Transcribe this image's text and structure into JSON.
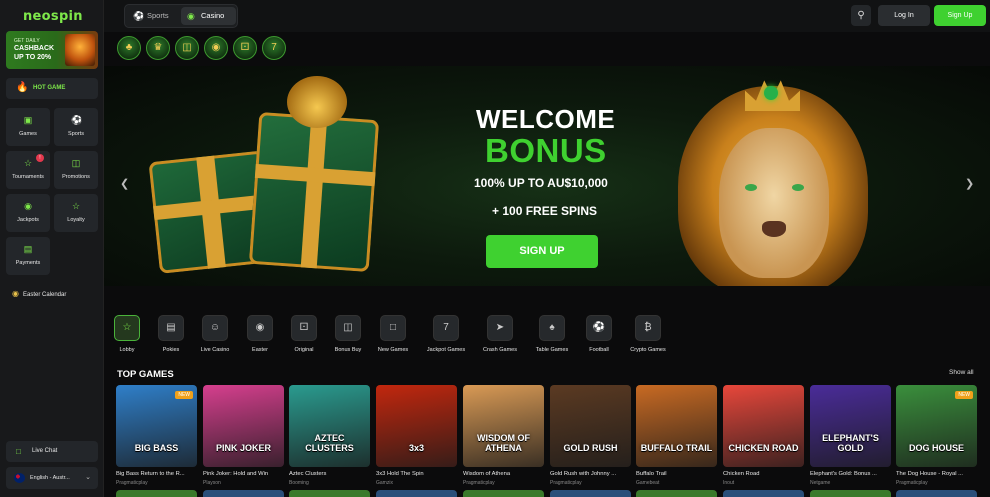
{
  "brand": {
    "logo_text": "neospin",
    "accent": "#3fd130"
  },
  "sidebar": {
    "promo": {
      "line1": "GET DAILY",
      "line2": "CASHBACK",
      "line3": "UP TO 20%"
    },
    "hot_game": "HOT GAME",
    "tiles": [
      {
        "label": "Games",
        "icon": "games-icon"
      },
      {
        "label": "Sports",
        "icon": "soccer-ball-icon"
      },
      {
        "label": "Tournaments",
        "icon": "trophy-icon",
        "badge": "!"
      },
      {
        "label": "Promotions",
        "icon": "gift-icon"
      },
      {
        "label": "Jackpots",
        "icon": "coins-icon"
      },
      {
        "label": "Loyalty",
        "icon": "star-icon"
      },
      {
        "label": "Payments",
        "icon": "cash-icon"
      }
    ],
    "easter": "Easter Calendar",
    "live_chat": "Live Chat",
    "language": "English - Austr..."
  },
  "topbar": {
    "sports_tab": "Sports",
    "casino_tab": "Casino",
    "login": "Log In",
    "signup": "Sign Up"
  },
  "banner": {
    "welcome": "WELCOME",
    "bonus": "BONUS",
    "offer": "100% UP TO AU$10,000",
    "spins": "+ 100 FREE SPINS",
    "cta": "SIGN UP",
    "slides": 6,
    "active_slide": 1
  },
  "categories": [
    {
      "label": "Lobby",
      "icon": "lobby-icon",
      "active": true
    },
    {
      "label": "Pokies",
      "icon": "slot-machine-icon"
    },
    {
      "label": "Live Casino",
      "icon": "live-dealer-icon"
    },
    {
      "label": "Easter",
      "icon": "easter-egg-icon"
    },
    {
      "label": "Original",
      "icon": "dice-icon"
    },
    {
      "label": "Bonus Buy",
      "icon": "gift-box-icon"
    },
    {
      "label": "New Games",
      "icon": "new-cards-icon"
    },
    {
      "label": "Jackpot Games",
      "icon": "jackpot-777-icon"
    },
    {
      "label": "Crash Games",
      "icon": "rocket-icon"
    },
    {
      "label": "Table Games",
      "icon": "cards-icon"
    },
    {
      "label": "Football",
      "icon": "football-icon"
    },
    {
      "label": "Crypto Games",
      "icon": "crypto-coin-icon"
    }
  ],
  "top_games": {
    "title": "TOP GAMES",
    "show_all": "Show all",
    "games": [
      {
        "name": "Big Bass Return to the R...",
        "provider": "Pragmaticplay",
        "art": "BIG BASS",
        "new": "NEW",
        "bg": "#2f7fc9"
      },
      {
        "name": "Pink Joker: Hold and Win",
        "provider": "Playson",
        "art": "PINK JOKER",
        "bg": "#d63f8e"
      },
      {
        "name": "Aztec Clusters",
        "provider": "Booming",
        "art": "AZTEC CLUSTERS",
        "bg": "#2a9b8f"
      },
      {
        "name": "3x3 Hold The Spin",
        "provider": "Gamzix",
        "art": "3x3",
        "bg": "#c2270e"
      },
      {
        "name": "Wisdom of Athena",
        "provider": "Pragmaticplay",
        "art": "WISDOM OF ATHENA",
        "bg": "#d99a55"
      },
      {
        "name": "Gold Rush with Johnny ...",
        "provider": "Pragmaticplay",
        "art": "GOLD RUSH",
        "bg": "#5b3a22"
      },
      {
        "name": "Buffalo Trail",
        "provider": "Gamebeat",
        "art": "BUFFALO TRAIL",
        "bg": "#c86a23"
      },
      {
        "name": "Chicken Road",
        "provider": "Inout",
        "art": "CHICKEN ROAD",
        "bg": "#e8473b"
      },
      {
        "name": "Elephant's Gold: Bonus ...",
        "provider": "Netgame",
        "art": "ELEPHANT'S GOLD",
        "bg": "#4a2c99"
      },
      {
        "name": "The Dog House - Royal ...",
        "provider": "Pragmaticplay",
        "art": "DOG HOUSE",
        "new": "NEW",
        "bg": "#3a8f3c"
      }
    ]
  }
}
